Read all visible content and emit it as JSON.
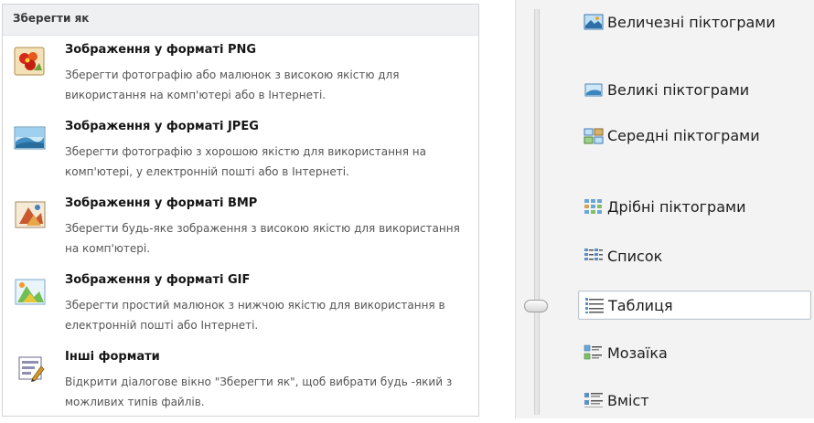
{
  "save_as": {
    "header": "Зберегти як",
    "items": [
      {
        "icon": "png-image-icon",
        "title": "Зображення у форматі PNG",
        "description": "Зберегти фотографію або малюнок з високою якістю для використання на комп'ютері або в Інтернеті."
      },
      {
        "icon": "jpeg-image-icon",
        "title": "Зображення у форматі JPEG",
        "description": "Зберегти фотографію з хорошою якістю для використання на комп'ютері, у електронній пошті або в Інтернеті."
      },
      {
        "icon": "bmp-image-icon",
        "title": "Зображення у форматі BMP",
        "description": "Зберегти будь-яке зображення з високою якістю для використання на комп'ютері."
      },
      {
        "icon": "gif-image-icon",
        "title": "Зображення у форматі GIF",
        "description": "Зберегти простий малюнок з нижчою якістю для використання в електронній пошті або Інтернеті."
      },
      {
        "icon": "other-formats-icon",
        "title": "Інші формати",
        "description": "Відкрити діалогове вікно \"Зберегти як\", щоб вибрати будь -який з можливих типів файлів."
      }
    ]
  },
  "view_menu": {
    "options": [
      {
        "icon": "extra-large-icons-icon",
        "label": "Величезні піктограми"
      },
      {
        "icon": "large-icons-icon",
        "label": "Великі піктограми"
      },
      {
        "icon": "medium-icons-icon",
        "label": "Середні піктограми"
      },
      {
        "icon": "small-icons-icon",
        "label": "Дрібні піктограми"
      },
      {
        "icon": "list-icon",
        "label": "Список"
      },
      {
        "icon": "details-icon",
        "label": "Таблиця"
      },
      {
        "icon": "tiles-icon",
        "label": "Мозаїка"
      },
      {
        "icon": "content-icon",
        "label": "Вміст"
      }
    ],
    "selected": "Таблиця"
  }
}
